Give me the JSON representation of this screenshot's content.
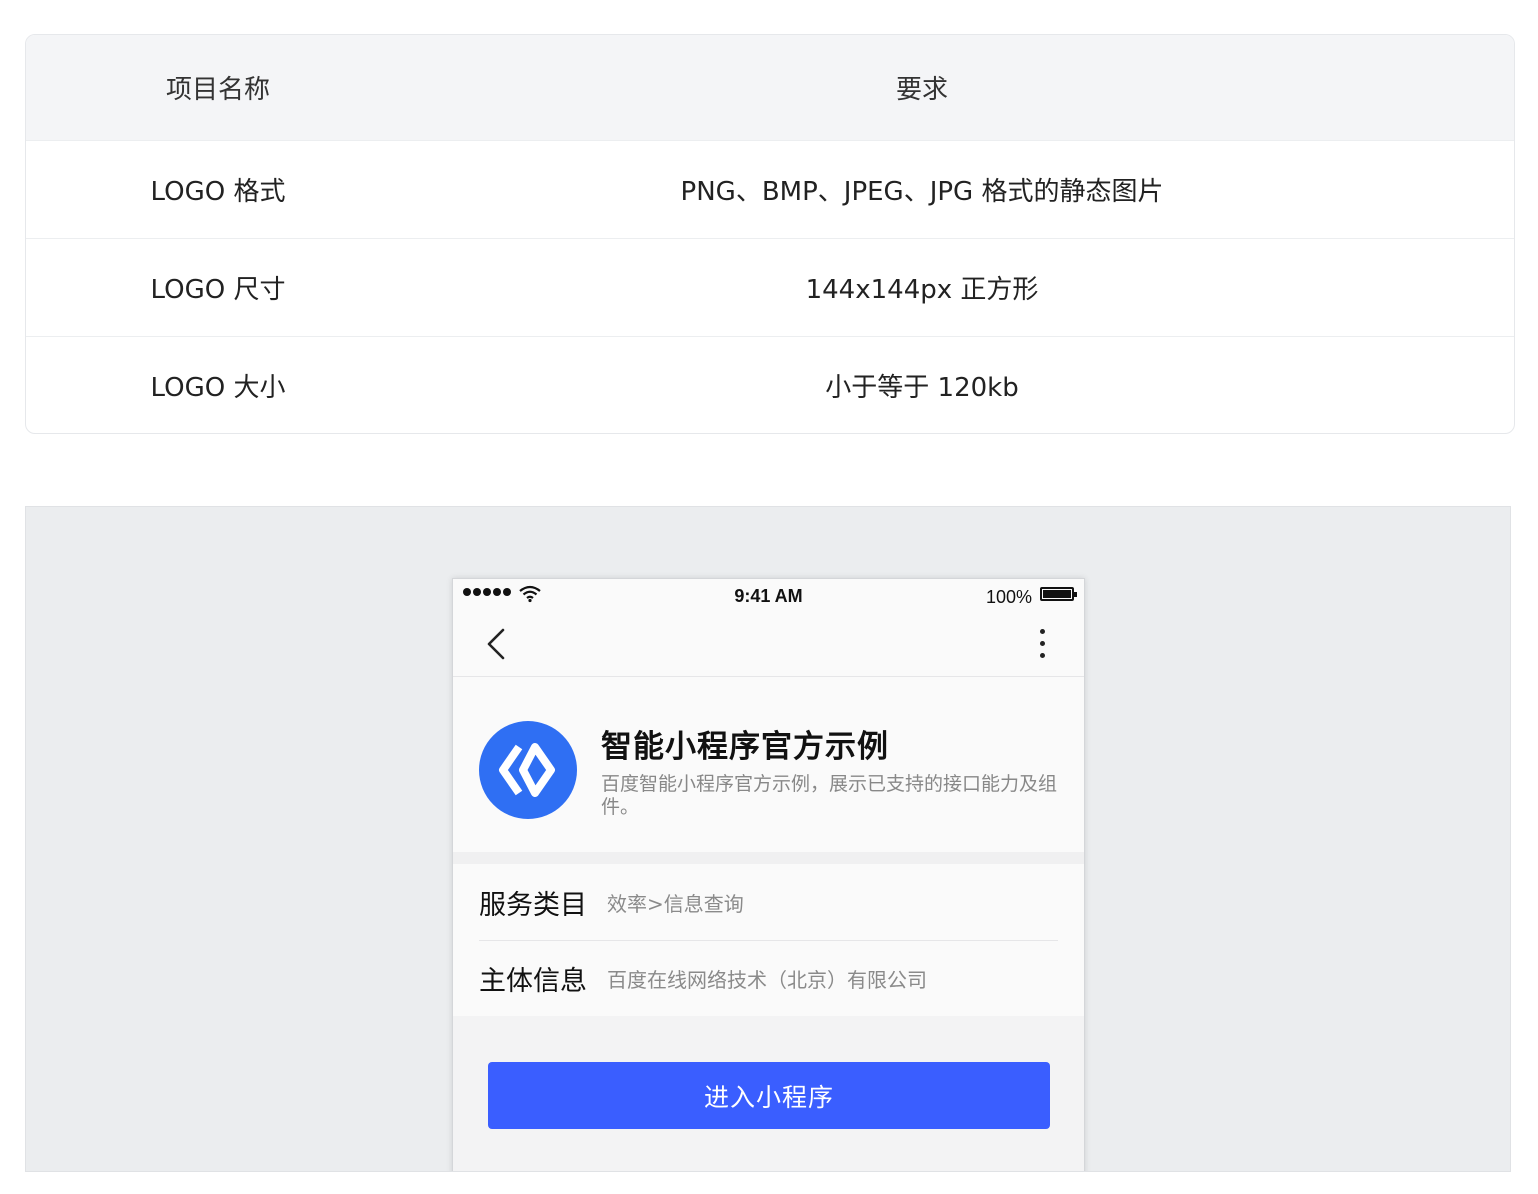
{
  "spec_table": {
    "header": {
      "name": "项目名称",
      "requirement": "要求"
    },
    "rows": [
      {
        "name": "LOGO 格式",
        "requirement": "PNG、BMP、JPEG、JPG 格式的静态图片"
      },
      {
        "name": "LOGO 尺寸",
        "requirement": "144x144px 正方形"
      },
      {
        "name": "LOGO 大小",
        "requirement": "小于等于 120kb"
      }
    ]
  },
  "phone": {
    "status_bar": {
      "time": "9:41 AM",
      "battery": "100%"
    },
    "nav": {
      "back_icon": "chevron-left-icon",
      "more_icon": "vertical-ellipsis-icon"
    },
    "app": {
      "name": "智能小程序官方示例",
      "description": "百度智能小程序官方示例，展示已支持的接口能力及组件。",
      "logo_color": "#2f6ff3"
    },
    "info": [
      {
        "label": "服务类目",
        "value": "效率>信息查询"
      },
      {
        "label": "主体信息",
        "value": "百度在线网络技术（北京）有限公司"
      }
    ],
    "enter_button": {
      "label": "进入小程序",
      "color": "#3a5eff"
    }
  }
}
